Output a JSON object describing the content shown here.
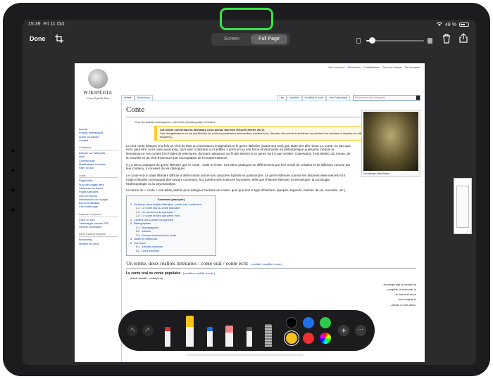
{
  "status": {
    "time": "15:39",
    "date": "Fri 11 Oct",
    "battery": "48 %"
  },
  "toolbar": {
    "done_label": "Done",
    "mode_screen": "Screen",
    "mode_full_page": "Full Page",
    "opacity_level": 0.1
  },
  "wiki": {
    "user_links": [
      "Non connecté",
      "Discussion",
      "Contributions",
      "Créer un compte",
      "Se connecter"
    ],
    "logo_title": "WIKIPÉDIA",
    "logo_sub": "L'encyclopédie libre",
    "tabs_left": [
      "Article",
      "Discussion"
    ],
    "tabs_right": [
      "Lire",
      "Modifier",
      "Modifier le code",
      "Voir l'historique"
    ],
    "search_placeholder": "Rechercher dans Wikipédia",
    "nav": [
      {
        "head": "",
        "items": [
          "Accueil",
          "Portails thématiques",
          "Article au hasard",
          "Contact"
        ]
      },
      {
        "head": "Contribuer",
        "items": [
          "Débuter sur Wikipédia",
          "Aide",
          "Communauté",
          "Modifications récentes",
          "Faire un don"
        ]
      },
      {
        "head": "Outils",
        "items": [
          "Pages liées",
          "Suivi des pages liées",
          "Téléverser un fichier",
          "Pages spéciales",
          "Lien permanent",
          "Informations sur la page",
          "Élément Wikidata",
          "Citer cette page"
        ]
      },
      {
        "head": "Imprimer / exporter",
        "items": [
          "Créer un livre",
          "Télécharger comme PDF",
          "Version imprimable"
        ]
      },
      {
        "head": "Dans d'autres langues",
        "items": [
          "Brezhoneg",
          "Modifier les liens"
        ]
      }
    ],
    "title": "Conte",
    "hatnote": "Pour les articles homonymes, voir Conte (homonymie) et Contes.",
    "ambox_title": "Cet article concernant la littérature ou la poésie doit être recyclé (février 2017).",
    "ambox_text": "Une réorganisation et une clarification du contenu paraissent nécessaires. Améliorez-le, discutez des points à améliorer ou précisez les sections à recycler en utilisant {{section à recycler}}.",
    "paras": [
      "Le mot conte désigne à la fois un récit de faits ou d'aventures imaginaires et le genre littéraire (avant tout oral) qui relate des dits récits. Le conte, en tant que récit, peut être court mais aussi long. Qu'il vise à distraire ou à édifier, il porte en lui une force émotionnelle ou philosophique puissante. Depuis la Renaissance, les contes font l'objet de relectures, donnant naissance au fil des siècles à un genre écrit à part entière. Cependant, il est distinct du roman, de la nouvelle et du récit d'aventure par l'acceptation de l'invraisemblance.",
      "Il y a deux pratiques du genre littéraire que le conte : orale et écrite. Ces deux pratiques se différencient par leur mode de création et de diffusion comme par leur contenu, il convient de les distinguer.",
      "Le conte est un objet littéraire difficile à définir étant donné son caractère hybride et polymorphe. Le genre littéraire comme les histoires elles-mêmes font l'objet d'études convoquant des savoirs connexes, à la lumière des sciences humaines, telle que l'histoire littéraire, la sémiologie, la sociologie, l'anthropologie ou la psychanalyse.",
      "Le terme de « conte » est utilisé parfois pour désigner l'activité de conter, quel que soit le type d'histoires (épopée, légende, histoire de vie, nouvelle, etc.)."
    ],
    "image_caption": "Un troll par John Bauer",
    "toc_title": "Sommaire [masquer]",
    "toc": [
      {
        "n": "1",
        "t": "Un terme, deux réalités littéraires : conte oral / conte écrit",
        "lvl": 1
      },
      {
        "n": "1.1",
        "t": "Le conte oral ou conte populaire",
        "lvl": 2
      },
      {
        "n": "1.2",
        "t": "Un nouvel art du spectacle ?",
        "lvl": 2
      },
      {
        "n": "1.3",
        "t": "Le conte en tant que genre écrit",
        "lvl": 2
      },
      {
        "n": "2",
        "t": "Centres des Contes et Légendes",
        "lvl": 1
      },
      {
        "n": "3",
        "t": "Bibliographies",
        "lvl": 1
      },
      {
        "n": "3.1",
        "t": "Monographies",
        "lvl": 2
      },
      {
        "n": "3.2",
        "t": "Articles",
        "lvl": 2
      },
      {
        "n": "3.3",
        "t": "Revues consacrées au conte",
        "lvl": 2
      },
      {
        "n": "4",
        "t": "Notes et références",
        "lvl": 1
      },
      {
        "n": "5",
        "t": "Voir aussi",
        "lvl": 1
      },
      {
        "n": "5.1",
        "t": "Articles connexes",
        "lvl": 2
      },
      {
        "n": "5.2",
        "t": "Liens externes",
        "lvl": 2
      }
    ],
    "h2": "Un terme, deux réalités littéraires : conte oral / conte écrit",
    "h2_edit": "[ modifier | modifier le code ]",
    "h3": "Le conte oral ou conte populaire",
    "h3_edit": "[ modifier | modifier le code ]",
    "detail": "Article détaillé : conte (oral).",
    "bottom_fragments": [
      "...les temps régi la création et",
      "...complète, le mémoral, la",
      "...le mémoral qu se",
      "...nent végétal et",
      "...peuple ou des dieux."
    ]
  },
  "palette": {
    "colors": [
      "#000000",
      "#1e6fe8",
      "#30c84a",
      "#f7c31c",
      "#ee3030",
      "multicolor"
    ],
    "selected_color": "#f7c31c",
    "tools": [
      "pen",
      "marker",
      "pencil",
      "eraser",
      "lasso",
      "ruler"
    ]
  }
}
